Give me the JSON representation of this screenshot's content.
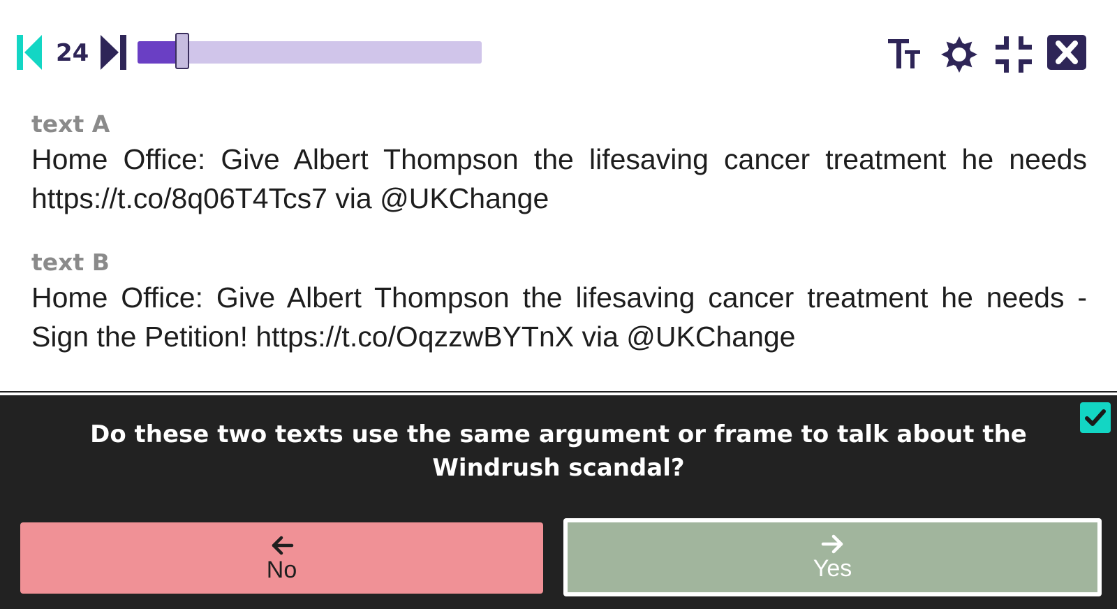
{
  "toolbar": {
    "counter": "24",
    "progress_fraction": 0.11
  },
  "texts": [
    {
      "label": "text A",
      "body": "Home Office: Give Albert Thompson the lifesaving cancer treatment he needs https://t.co/8q06T4Tcs7 via @UKChange"
    },
    {
      "label": "text B",
      "body": "Home Office: Give Albert Thompson the lifesaving cancer treatment he needs - Sign the Petition! https://t.co/OqzzwBYTnX via @UKChange"
    }
  ],
  "question": "Do these two texts use the same argument or frame to talk about the Windrush scandal?",
  "answers": {
    "no_label": "No",
    "yes_label": "Yes"
  },
  "colors": {
    "accent_teal": "#13d6c4",
    "accent_purple": "#6a3fc4",
    "icon_dark": "#2e2557",
    "no_button": "#f09196",
    "yes_button": "#a1b59d",
    "panel_bg": "#222222"
  },
  "icons": {
    "first": "skip-to-first-icon",
    "last": "skip-to-last-icon",
    "font_size": "text-size-icon",
    "settings": "gear-icon",
    "collapse": "collapse-fullscreen-icon",
    "close": "close-icon",
    "check": "checkmark-icon",
    "left_arrow": "arrow-left-icon",
    "right_arrow": "arrow-right-icon"
  }
}
